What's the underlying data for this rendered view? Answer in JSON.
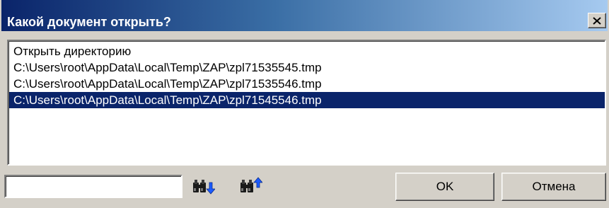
{
  "dialog": {
    "title": "Какой документ открыть?",
    "close_icon": "close-icon"
  },
  "list": {
    "items": [
      {
        "label": "Открыть директорию",
        "selected": false
      },
      {
        "label": "C:\\Users\\root\\AppData\\Local\\Temp\\ZAP\\zpl71535545.tmp",
        "selected": false
      },
      {
        "label": "C:\\Users\\root\\AppData\\Local\\Temp\\ZAP\\zpl71535546.tmp",
        "selected": false
      },
      {
        "label": "C:\\Users\\root\\AppData\\Local\\Temp\\ZAP\\zpl71545546.tmp",
        "selected": true
      }
    ]
  },
  "search": {
    "value": "",
    "find_next_icon": "binoculars-down-icon",
    "find_prev_icon": "binoculars-up-icon"
  },
  "buttons": {
    "ok_label": "OK",
    "cancel_label": "Отмена"
  },
  "colors": {
    "title_gradient_start": "#0a246a",
    "title_gradient_end": "#a6caf0",
    "selection": "#0a246a",
    "face": "#d4d0c8",
    "arrow_blue": "#1c5cff"
  }
}
